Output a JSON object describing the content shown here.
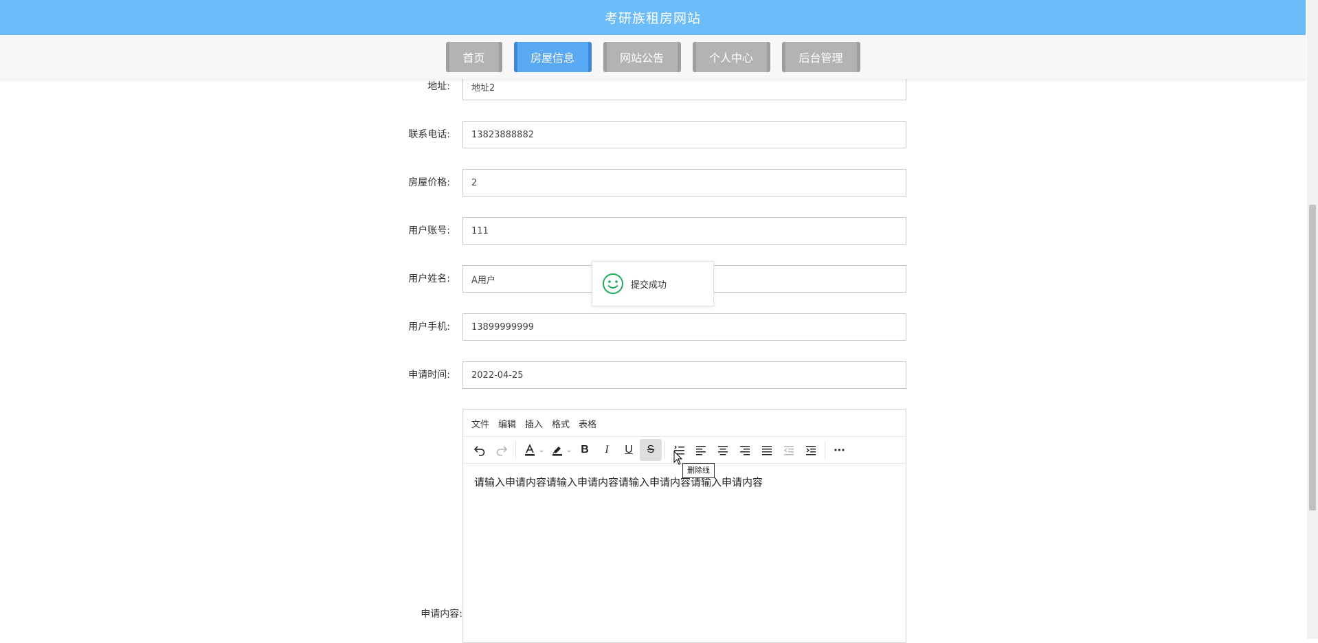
{
  "header": {
    "title": "考研族租房网站"
  },
  "nav": {
    "items": [
      {
        "label": "首页",
        "active": false
      },
      {
        "label": "房屋信息",
        "active": true
      },
      {
        "label": "网站公告",
        "active": false
      },
      {
        "label": "个人中心",
        "active": false
      },
      {
        "label": "后台管理",
        "active": false
      }
    ]
  },
  "form": {
    "fields": [
      {
        "label": "地址:",
        "value": "地址2"
      },
      {
        "label": "联系电话:",
        "value": "13823888882"
      },
      {
        "label": "房屋价格:",
        "value": "2"
      },
      {
        "label": "用户账号:",
        "value": "111"
      },
      {
        "label": "用户姓名:",
        "value": "A用户"
      },
      {
        "label": "用户手机:",
        "value": "13899999999"
      },
      {
        "label": "申请时间:",
        "value": "2022-04-25"
      }
    ],
    "content_label": "申请内容:"
  },
  "editor": {
    "menu": [
      "文件",
      "编辑",
      "插入",
      "格式",
      "表格"
    ],
    "content": "请输入申请内容请输入申请内容请输入申请内容请输入申请内容",
    "tooltip": "删除线",
    "toolbar": {
      "bold": "B",
      "italic": "I",
      "underline": "U",
      "strikethrough": "S",
      "more": "•••"
    }
  },
  "toast": {
    "message": "提交成功",
    "icon": "smiley-icon",
    "icon_color": "#1aad5e"
  },
  "colors": {
    "header_bg": "#6bbcf8",
    "nav_active": "#5aa9f3",
    "nav_inactive": "#b3b3b3"
  }
}
